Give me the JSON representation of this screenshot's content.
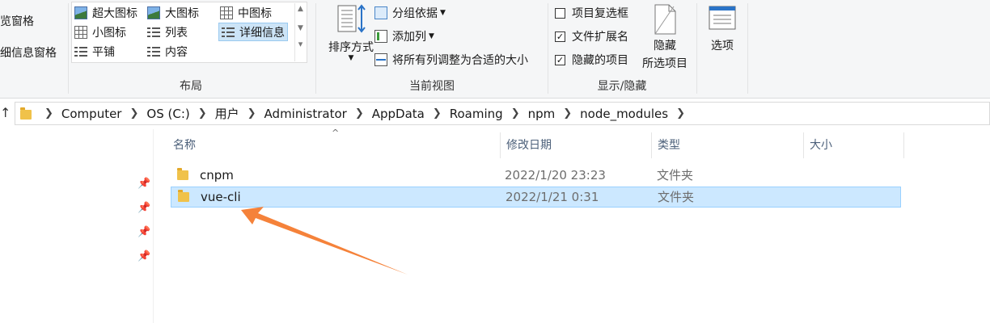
{
  "ribbon": {
    "pane": {
      "preview_pane": "览窗格",
      "details_pane": "细信息窗格"
    },
    "layout": {
      "label": "布局",
      "items": [
        {
          "label": "超大图标",
          "icon": "extra-large-icons-icon"
        },
        {
          "label": "大图标",
          "icon": "large-icons-icon"
        },
        {
          "label": "中图标",
          "icon": "medium-icons-icon"
        },
        {
          "label": "小图标",
          "icon": "small-icons-icon"
        },
        {
          "label": "列表",
          "icon": "list-icon"
        },
        {
          "label": "详细信息",
          "icon": "details-icon",
          "selected": true
        },
        {
          "label": "平铺",
          "icon": "tiles-icon"
        },
        {
          "label": "内容",
          "icon": "content-icon"
        }
      ]
    },
    "current_view": {
      "label": "当前视图",
      "sort_by": "排序方式",
      "group_by": "分组依据",
      "add_columns": "添加列",
      "size_all_columns": "将所有列调整为合适的大小"
    },
    "show_hide": {
      "label": "显示/隐藏",
      "item_checkboxes": {
        "label": "项目复选框",
        "checked": false
      },
      "file_extensions": {
        "label": "文件扩展名",
        "checked": true
      },
      "hidden_items": {
        "label": "隐藏的项目",
        "checked": true
      },
      "hide_selected_line1": "隐藏",
      "hide_selected_line2": "所选项目"
    },
    "options": {
      "label": "选项"
    }
  },
  "address_bar": {
    "crumbs": [
      "Computer",
      "OS (C:)",
      "用户",
      "Administrator",
      "AppData",
      "Roaming",
      "npm",
      "node_modules"
    ]
  },
  "columns": {
    "name": "名称",
    "date_modified": "修改日期",
    "type": "类型",
    "size": "大小"
  },
  "files": [
    {
      "name": "cnpm",
      "date": "2022/1/20 23:23",
      "type": "文件夹",
      "selected": false
    },
    {
      "name": "vue-cli",
      "date": "2022/1/21 0:31",
      "type": "文件夹",
      "selected": true
    }
  ],
  "colors": {
    "selection_bg": "#cce8ff",
    "selection_border": "#99d1ff",
    "folder": "#f0c24a",
    "annotation_arrow": "#f5823a"
  }
}
